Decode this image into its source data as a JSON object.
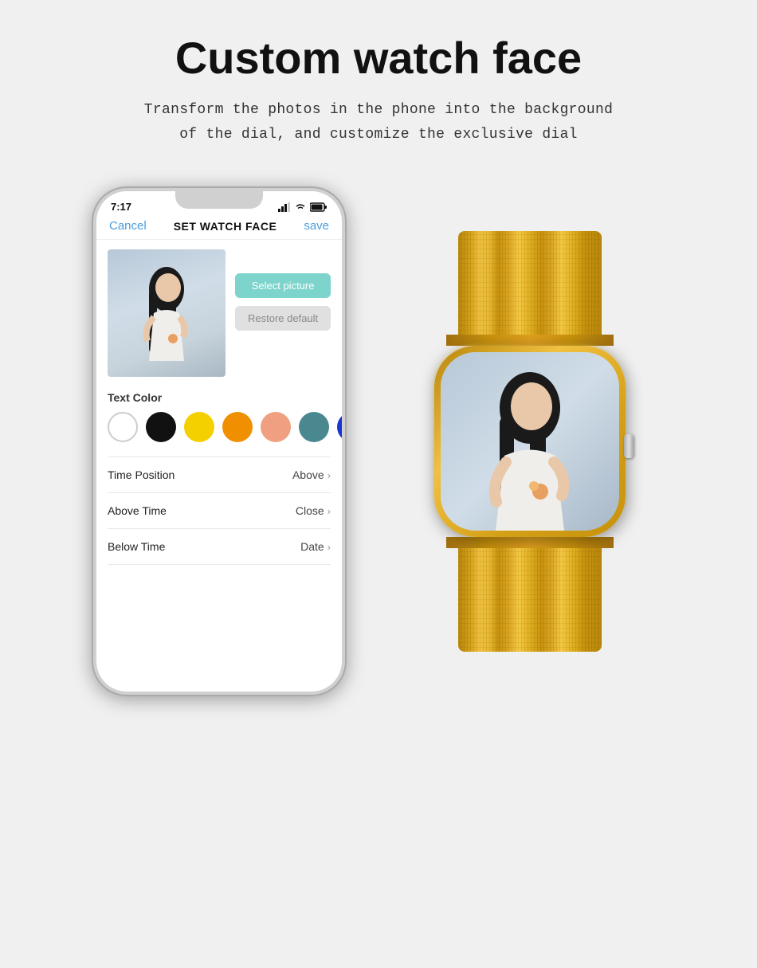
{
  "page": {
    "title": "Custom watch face",
    "subtitle_line1": "Transform the photos in the phone into the background",
    "subtitle_line2": "of the dial, and customize the exclusive dial"
  },
  "phone": {
    "status_time": "7:17",
    "signal_icon": "signal",
    "wifi_icon": "wifi",
    "battery_icon": "battery",
    "header": {
      "cancel_label": "Cancel",
      "title": "SET WATCH FACE",
      "save_label": "save"
    },
    "buttons": {
      "select_picture": "Select picture",
      "restore_default": "Restore default"
    },
    "text_color_label": "Text Color",
    "colors": [
      "white",
      "black",
      "yellow",
      "orange",
      "salmon",
      "teal",
      "blue"
    ],
    "settings": [
      {
        "label": "Time Position",
        "value": "Above"
      },
      {
        "label": "Above Time",
        "value": "Close"
      },
      {
        "label": "Below Time",
        "value": "Date"
      }
    ]
  }
}
